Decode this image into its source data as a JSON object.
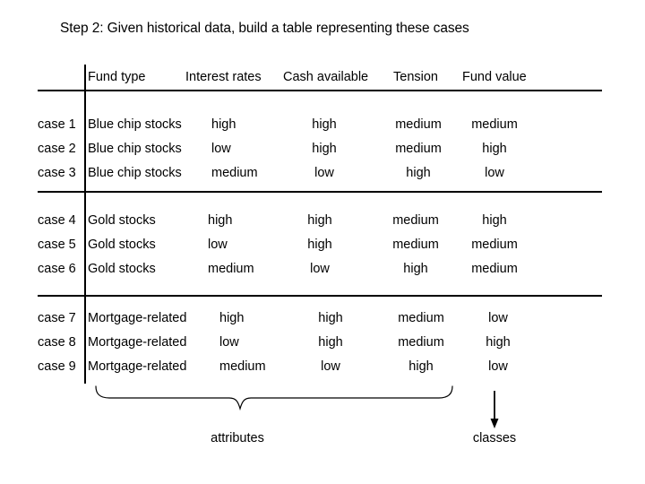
{
  "slide": {
    "title": "Step 2: Given historical data, build a table representing these cases"
  },
  "table": {
    "corner_label": "",
    "columns": [
      {
        "key": "case",
        "label": ""
      },
      {
        "key": "fund",
        "label": "Fund type"
      },
      {
        "key": "rates",
        "label": "Interest rates"
      },
      {
        "key": "cash",
        "label": "Cash available"
      },
      {
        "key": "tension",
        "label": "Tension"
      },
      {
        "key": "value",
        "label": "Fund value"
      }
    ],
    "groups": [
      {
        "name": "blue-chip-stocks",
        "rows": [
          {
            "case": "case 1",
            "fund": "Blue chip stocks",
            "rates": "high",
            "cash": "high",
            "tension": "medium",
            "value": "medium"
          },
          {
            "case": "case 2",
            "fund": "Blue chip stocks",
            "rates": "low",
            "cash": "high",
            "tension": "medium",
            "value": "high"
          },
          {
            "case": "case 3",
            "fund": "Blue chip stocks",
            "rates": "medium",
            "cash": "low",
            "tension": "high",
            "value": "low"
          }
        ]
      },
      {
        "name": "gold-stocks",
        "rows": [
          {
            "case": "case 4",
            "fund": "Gold stocks",
            "rates": "high",
            "cash": "high",
            "tension": "medium",
            "value": "high"
          },
          {
            "case": "case 5",
            "fund": "Gold stocks",
            "rates": "low",
            "cash": "high",
            "tension": "medium",
            "value": "medium"
          },
          {
            "case": "case 6",
            "fund": "Gold stocks",
            "rates": "medium",
            "cash": "low",
            "tension": "high",
            "value": "medium"
          }
        ]
      },
      {
        "name": "mortgage-related",
        "rows": [
          {
            "case": "case 7",
            "fund": "Mortgage-related",
            "rates": "high",
            "cash": "high",
            "tension": "medium",
            "value": "low"
          },
          {
            "case": "case 8",
            "fund": "Mortgage-related",
            "rates": "low",
            "cash": "high",
            "tension": "medium",
            "value": "high"
          },
          {
            "case": "case 9",
            "fund": "Mortgage-related",
            "rates": "medium",
            "cash": "low",
            "tension": "high",
            "value": "low"
          }
        ]
      }
    ]
  },
  "annotations": {
    "attributes_label": "attributes",
    "classes_label": "classes"
  },
  "colors": {
    "background": "#ffffff",
    "ink": "#000000"
  }
}
